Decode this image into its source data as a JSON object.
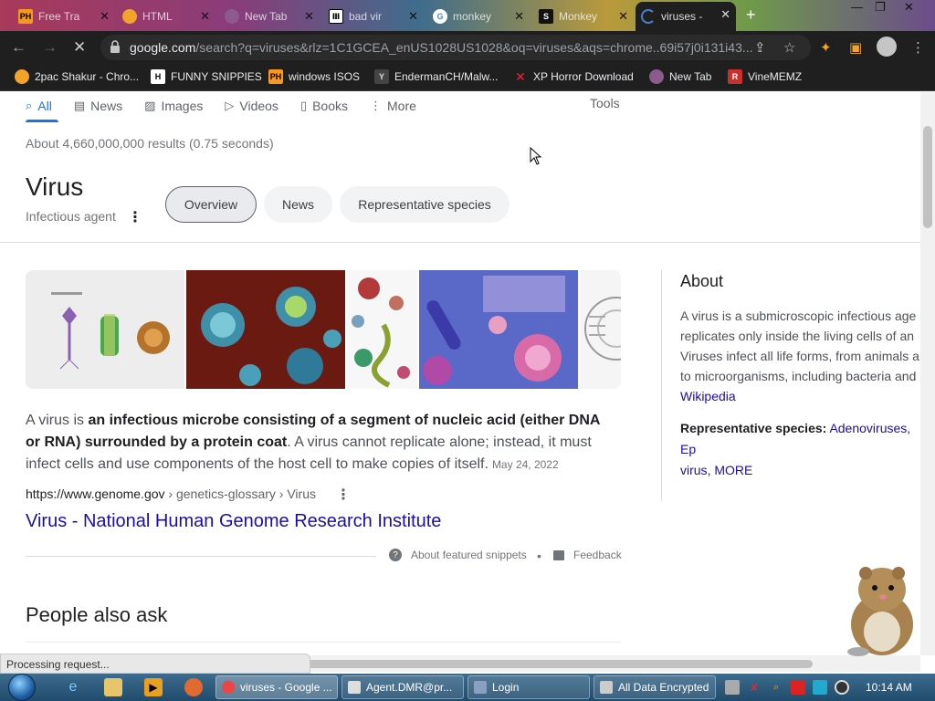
{
  "browser": {
    "tabs": [
      {
        "icon": "ph-icon",
        "label": "Free Tra",
        "active": false
      },
      {
        "icon": "html-icon",
        "label": "HTML",
        "active": false
      },
      {
        "icon": "newtab-icon",
        "label": "New Tab",
        "active": false
      },
      {
        "icon": "bank-icon",
        "label": "bad vir",
        "active": false
      },
      {
        "icon": "google-icon",
        "label": "monkey",
        "active": false
      },
      {
        "icon": "s-icon",
        "label": "Monkey",
        "active": false
      },
      {
        "icon": "loading-icon",
        "label": "viruses -",
        "active": true
      }
    ],
    "url_domain": "google.com",
    "url_path": "/search?q=viruses&rlz=1C1GCEA_enUS1028US1028&oq=viruses&aqs=chrome..69i57j0i131i43...",
    "bookmarks": [
      {
        "icon": "ph-icon",
        "label": "2pac Shakur - Chro..."
      },
      {
        "icon": "h-icon",
        "label": "FUNNY SNIPPIES"
      },
      {
        "icon": "ph-icon",
        "label": "windows ISOS"
      },
      {
        "icon": "yt-icon",
        "label": "EndermanCH/Malw..."
      },
      {
        "icon": "x-icon",
        "label": "XP Horror Download"
      },
      {
        "icon": "newtab-icon",
        "label": "New Tab"
      },
      {
        "icon": "r-icon",
        "label": "VineMEMZ"
      }
    ]
  },
  "search": {
    "tabs": [
      "All",
      "News",
      "Images",
      "Videos",
      "Books",
      "More"
    ],
    "tools": "Tools",
    "stats": "About 4,660,000,000 results (0.75 seconds)"
  },
  "knowledge": {
    "title": "Virus",
    "subtitle": "Infectious agent",
    "chips": [
      "Overview",
      "News",
      "Representative species"
    ]
  },
  "snippet": {
    "lead": "A virus is ",
    "bold": "an infectious microbe consisting of a segment of nucleic acid (either DNA or RNA) surrounded by a protein coat",
    "rest": ". A virus cannot replicate alone; instead, it must infect cells and use components of the host cell to make copies of itself.",
    "date": "May 24, 2022",
    "cite_domain": "https://www.genome.gov",
    "cite_path": " › genetics-glossary › Virus",
    "link": "Virus - National Human Genome Research Institute",
    "about_snippets": "About featured snippets",
    "feedback": "Feedback"
  },
  "paa": {
    "title": "People also ask"
  },
  "about": {
    "heading": "About",
    "lines": [
      "A virus is a submicroscopic infectious age",
      "replicates only inside the living cells of an",
      "Viruses infect all life forms, from animals a",
      "to microorganisms, including bacteria and"
    ],
    "source": "Wikipedia",
    "rep_label": "Representative species:",
    "rep_items": "Adenoviruses, Ep",
    "rep_items2": "virus",
    "rep_more": "MORE"
  },
  "status_text": "Processing request...",
  "taskbar": {
    "buttons": [
      "viruses - Google ...",
      "Agent.DMR@pr...",
      "Login",
      "All Data Encrypted"
    ],
    "clock": "10:14 AM"
  },
  "colors": {
    "link": "#1a0dab",
    "accent": "#1a73e8",
    "chrome_dark": "#1f1f1f"
  }
}
